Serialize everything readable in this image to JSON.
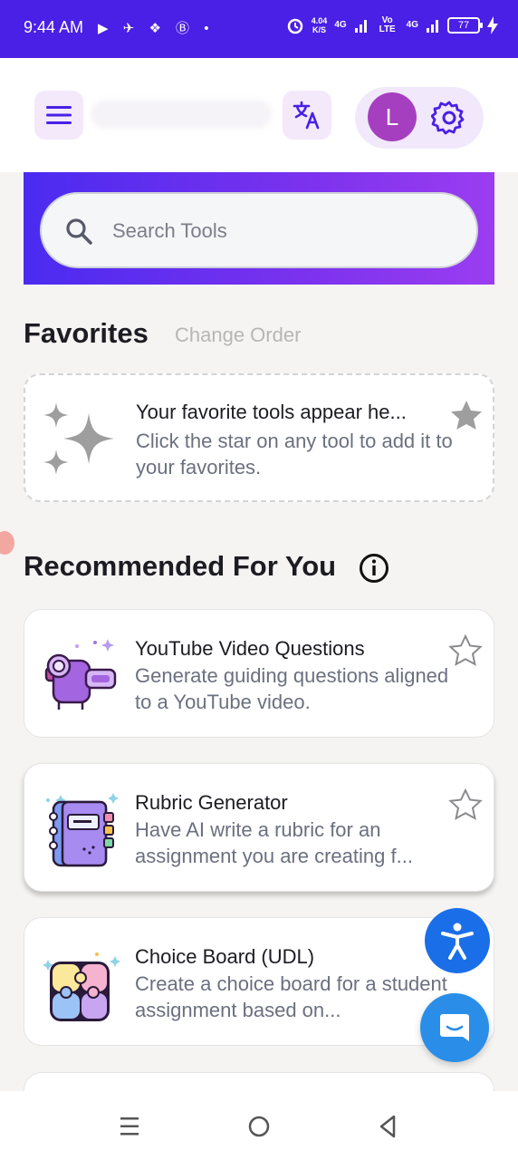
{
  "status_bar": {
    "time": "9:44 AM",
    "net_speed": "4.04",
    "net_speed_unit": "K/S",
    "sig1_label": "4G",
    "volte_label": "Vo LTE",
    "sig2_label": "4G",
    "battery": "77",
    "left_icons": "▶ ✈ ❖ Ⓑ •"
  },
  "header": {
    "menu_icon": "hamburger-menu-icon",
    "translate_icon": "translate-icon",
    "avatar_initial": "L",
    "settings_icon": "gear-icon"
  },
  "search": {
    "placeholder": "Search Tools"
  },
  "favorites": {
    "title": "Favorites",
    "change_order": "Change Order",
    "empty_heading": "Your favorite tools appear he...",
    "empty_desc": "Click the star on any tool to add it to your favorites."
  },
  "recommended": {
    "title": "Recommended For You",
    "tools": [
      {
        "name": "YouTube Video Questions",
        "desc": "Generate guiding questions aligned to a YouTube video.",
        "icon": "video-camera-icon"
      },
      {
        "name": "Rubric Generator",
        "desc": "Have AI write a rubric for an assignment you are creating f...",
        "icon": "notebook-icon"
      },
      {
        "name": "Choice Board (UDL)",
        "desc": "Create a choice board for a student assignment based on...",
        "icon": "puzzle-icon"
      }
    ]
  },
  "colors": {
    "brand_purple": "#4a1fe6",
    "accent_violet": "#7b32ee",
    "accessibility_blue": "#1a6fe8",
    "chat_blue": "#2a8ee9"
  }
}
